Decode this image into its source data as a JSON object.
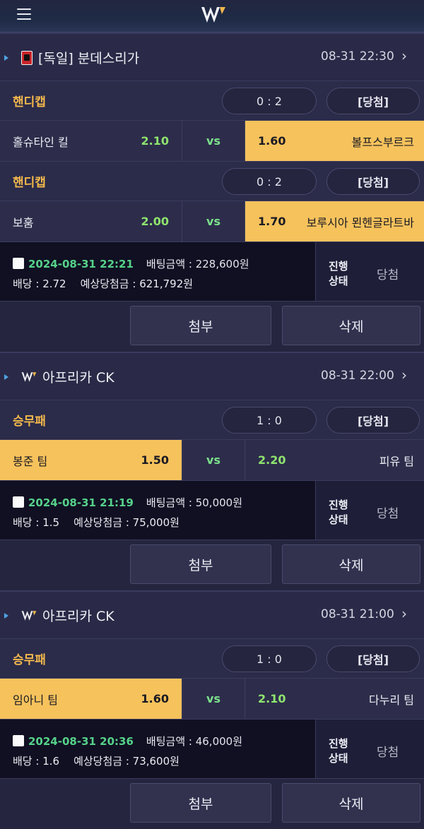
{
  "bets": [
    {
      "league": "[독일] 분데스리가",
      "league_icon": "bundesliga-badge",
      "datetime": "08-31 22:30",
      "markets": [
        {
          "market": "핸디캡",
          "score": "0 : 2",
          "result": "[당첨]",
          "home": "홀슈타인 킬",
          "home_odds": "2.10",
          "vs": "vs",
          "away_odds": "1.60",
          "away": "볼프스부르크",
          "selected": "away"
        },
        {
          "market": "핸디캡",
          "score": "0 : 2",
          "result": "[당첨]",
          "home": "보훔",
          "home_odds": "2.00",
          "vs": "vs",
          "away_odds": "1.70",
          "away": "보루시아 묀헨글라트바",
          "selected": "away"
        }
      ],
      "bet_time": "2024-08-31 22:21",
      "stake_label": "배팅금액 : ",
      "stake": "228,600원",
      "odds_label": "배당 : ",
      "odds": "2.72",
      "payout_label": "예상당첨금 : ",
      "payout": "621,792원",
      "status_label_1": "진행",
      "status_label_2": "상태",
      "status": "당첨",
      "attach_label": "첨부",
      "delete_label": "삭제"
    },
    {
      "league": "아프리카 CK",
      "league_icon": "w-logo",
      "datetime": "08-31 22:00",
      "markets": [
        {
          "market": "승무패",
          "score": "1 : 0",
          "result": "[당첨]",
          "home": "봉준 팀",
          "home_odds": "1.50",
          "vs": "vs",
          "away_odds": "2.20",
          "away": "피유 팀",
          "selected": "home"
        }
      ],
      "bet_time": "2024-08-31 21:19",
      "stake_label": "배팅금액 : ",
      "stake": "50,000원",
      "odds_label": "배당 : ",
      "odds": "1.5",
      "payout_label": "예상당첨금 : ",
      "payout": "75,000원",
      "status_label_1": "진행",
      "status_label_2": "상태",
      "status": "당첨",
      "attach_label": "첨부",
      "delete_label": "삭제"
    },
    {
      "league": "아프리카 CK",
      "league_icon": "w-logo",
      "datetime": "08-31 21:00",
      "markets": [
        {
          "market": "승무패",
          "score": "1 : 0",
          "result": "[당첨]",
          "home": "임아니 팀",
          "home_odds": "1.60",
          "vs": "vs",
          "away_odds": "2.10",
          "away": "다누리 팀",
          "selected": "home"
        }
      ],
      "bet_time": "2024-08-31 20:36",
      "stake_label": "배팅금액 : ",
      "stake": "46,000원",
      "odds_label": "배당 : ",
      "odds": "1.6",
      "payout_label": "예상당첨금 : ",
      "payout": "73,600원",
      "status_label_1": "진행",
      "status_label_2": "상태",
      "status": "당첨",
      "attach_label": "첨부",
      "delete_label": "삭제"
    }
  ],
  "colors": {
    "market": "#f3b94c",
    "odds": "#8fe46e",
    "selected": "#f6c25c",
    "datetime": "#56d28a",
    "accent": "#4fa3e3"
  }
}
